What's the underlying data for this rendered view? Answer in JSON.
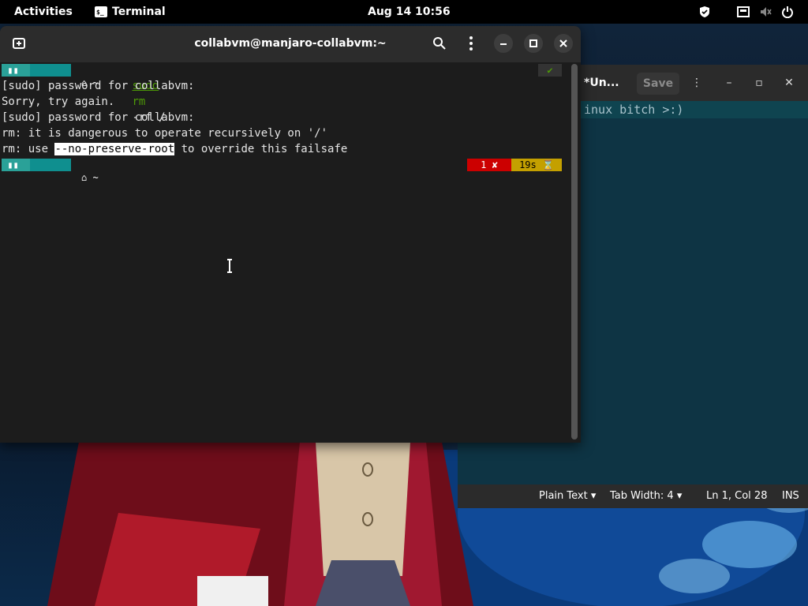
{
  "topbar": {
    "activities": "Activities",
    "app_name": "Terminal",
    "datetime": "Aug 14  10:56"
  },
  "terminal": {
    "title": "collabvm@manjaro-collabvm:~",
    "prompt_dir": "~",
    "command": {
      "sudo": "sudo",
      "rm": "rm",
      "args": "-rf /"
    },
    "lines": [
      "[sudo] password for collabvm:",
      "Sorry, try again.",
      "[sudo] password for collabvm:",
      "rm: it is dangerous to operate recursively on '/'"
    ],
    "last_line": {
      "before": "rm: use ",
      "highlight": "--no-preserve-root",
      "after": " to override this failsafe"
    },
    "status_ok": "✔",
    "exit_code": "1 ✘",
    "duration": "19s ⌛"
  },
  "gedit": {
    "title": "*Un...",
    "save": "Save",
    "text": "inux bitch >:)",
    "status": {
      "language": "Plain Text",
      "tab_width": "Tab Width: 4",
      "position": "Ln 1, Col 28",
      "mode": "INS"
    }
  },
  "colors": {
    "prompt_teal": "#0f8f8f",
    "prompt_green": "#2aa198",
    "error_red": "#cc0000",
    "time_yellow": "#c4a000"
  }
}
